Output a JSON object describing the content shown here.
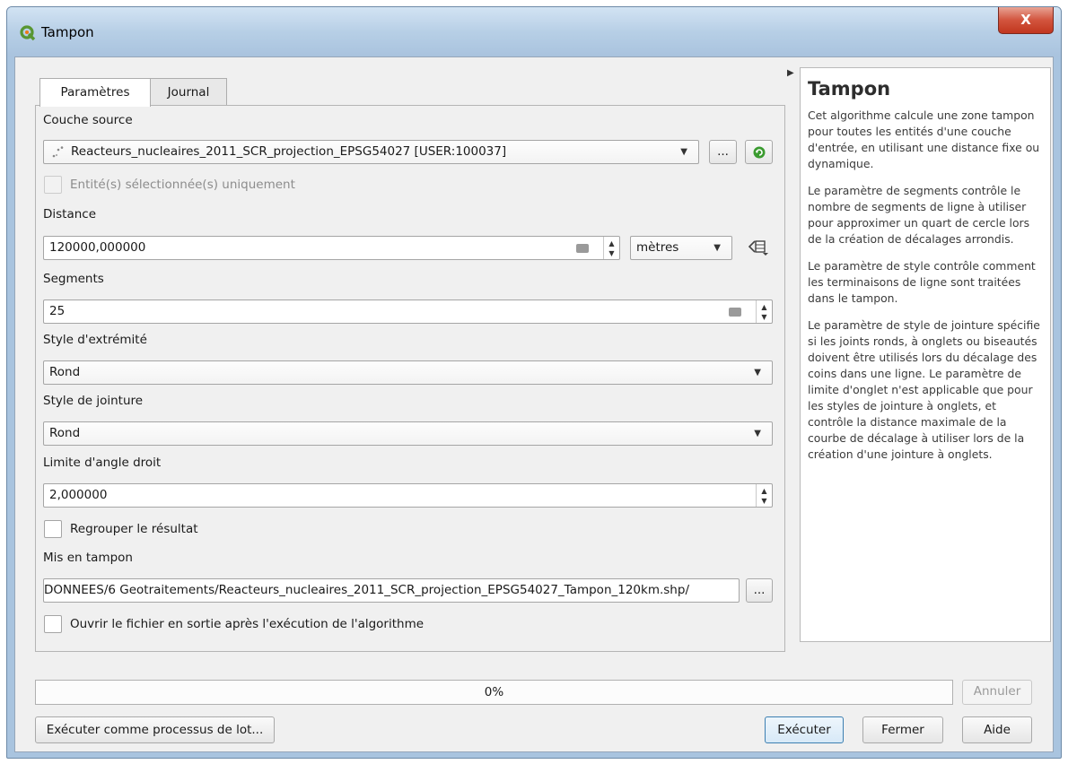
{
  "window": {
    "title": "Tampon",
    "close_label": "X"
  },
  "tabs": [
    {
      "label": "Paramètres"
    },
    {
      "label": "Journal"
    }
  ],
  "params": {
    "source_layer": {
      "label": "Couche source",
      "value": "Reacteurs_nucleaires_2011_SCR_projection_EPSG54027 [USER:100037]",
      "browse_label": "..."
    },
    "selected_only": {
      "label": "Entité(s) sélectionnée(s) uniquement"
    },
    "distance": {
      "label": "Distance",
      "value": "120000,000000",
      "unit": "mètres"
    },
    "segments": {
      "label": "Segments",
      "value": "25"
    },
    "end_cap": {
      "label": "Style d'extrémité",
      "value": "Rond"
    },
    "join_style": {
      "label": "Style de jointure",
      "value": "Rond"
    },
    "miter_limit": {
      "label": "Limite d'angle droit",
      "value": "2,000000"
    },
    "dissolve": {
      "label": "Regrouper le résultat"
    },
    "output": {
      "label": "Mis en tampon",
      "value": "/DONNEES/6 Geotraitements/Reacteurs_nucleaires_2011_SCR_projection_EPSG54027_Tampon_120km.shp",
      "browse_label": "..."
    },
    "open_output": {
      "label": "Ouvrir le fichier en sortie après l'exécution de l'algorithme"
    }
  },
  "help": {
    "title": "Tampon",
    "paragraphs": [
      "Cet algorithme calcule une zone tampon pour toutes les entités d'une couche d'entrée, en utilisant une distance fixe ou dynamique.",
      "Le paramètre de segments contrôle le nombre de segments de ligne à utiliser pour approximer un quart de cercle lors de la création de décalages arrondis.",
      "Le paramètre de style contrôle comment les terminaisons de ligne sont traitées dans le tampon.",
      "Le paramètre de style de jointure spécifie si les joints ronds, à onglets ou biseautés doivent être utilisés lors du décalage des coins dans une ligne. Le paramètre de limite d'onglet n'est applicable que pour les styles de jointure à onglets, et contrôle la distance maximale de la courbe de décalage à utiliser lors de la création d'une jointure à onglets."
    ]
  },
  "progress": {
    "text": "0%",
    "value": 0
  },
  "buttons": {
    "cancel": "Annuler",
    "batch": "Exécuter comme processus de lot...",
    "run": "Exécuter",
    "close": "Fermer",
    "help": "Aide"
  },
  "colors": {
    "qgis_green": "#589632",
    "refresh_green": "#3a9b2f",
    "accent_border": "#3c7fb1"
  }
}
